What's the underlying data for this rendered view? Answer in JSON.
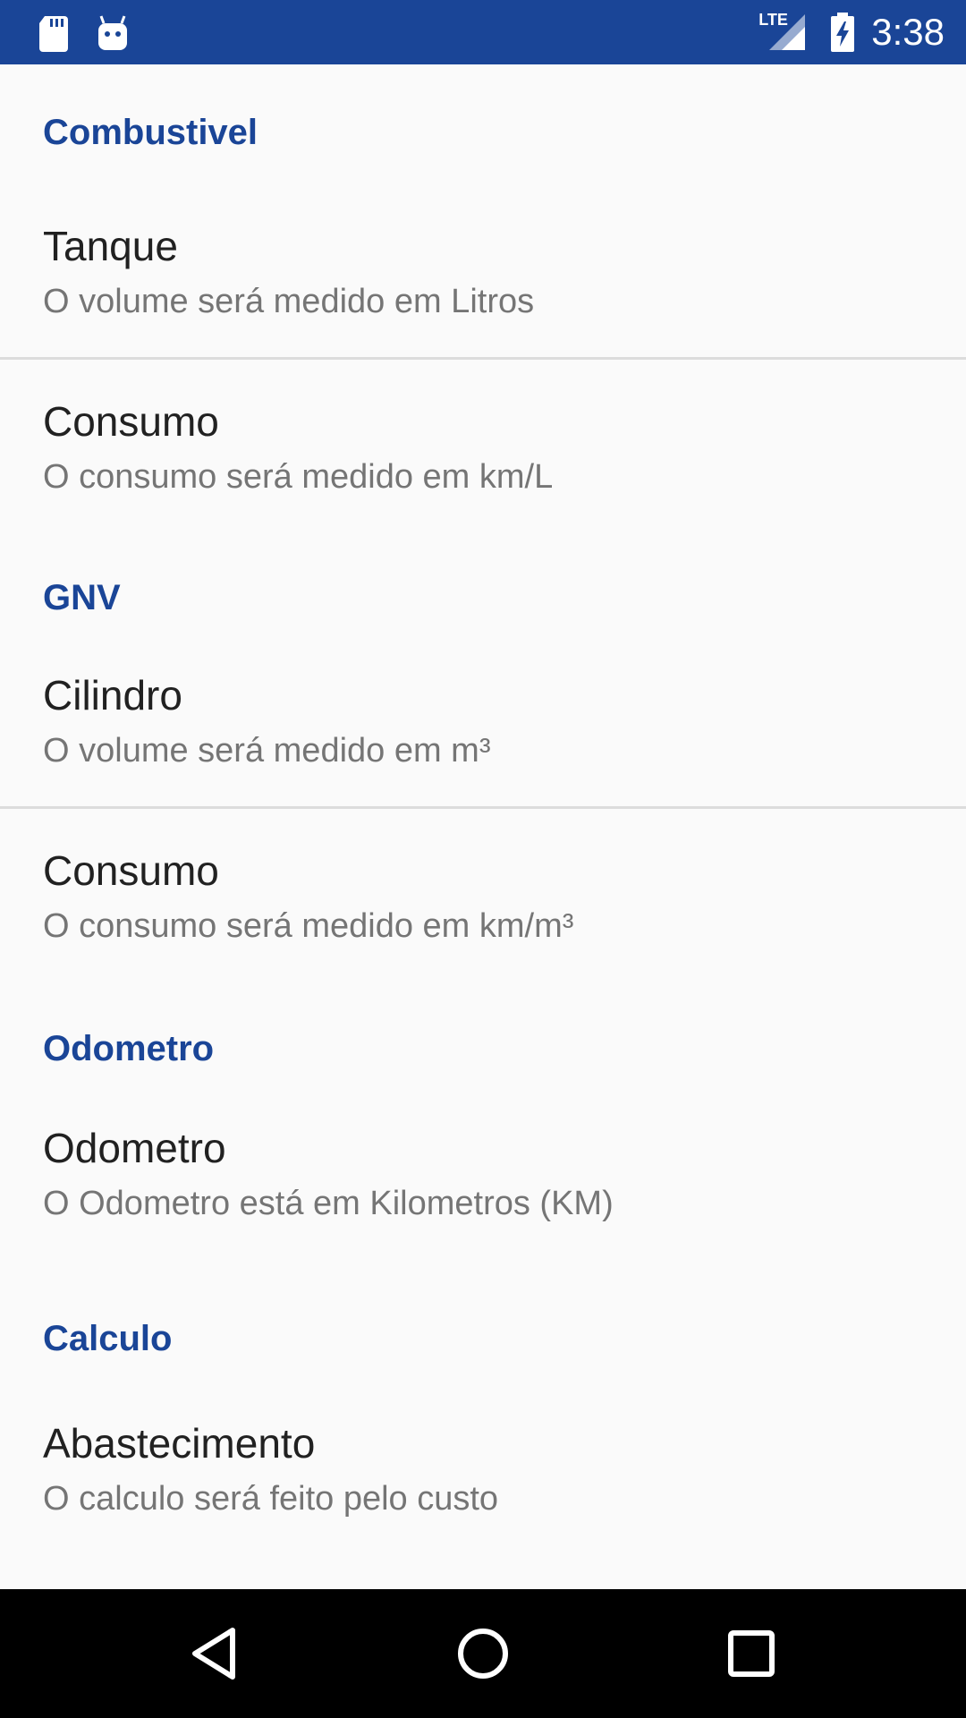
{
  "status_bar": {
    "time": "3:38",
    "network": "LTE",
    "icons": [
      "sd-card-icon",
      "android-icon",
      "lte-signal-icon",
      "battery-charging-icon"
    ],
    "background_color": "#1a4597"
  },
  "sections": [
    {
      "header": "Combustivel",
      "items": [
        {
          "title": "Tanque",
          "summary": "O volume será medido em Litros"
        },
        {
          "title": "Consumo",
          "summary": "O consumo será medido em km/L"
        }
      ]
    },
    {
      "header": "GNV",
      "items": [
        {
          "title": "Cilindro",
          "summary": "O volume será medido em m³"
        },
        {
          "title": "Consumo",
          "summary": "O consumo será medido em km/m³"
        }
      ]
    },
    {
      "header": "Odometro",
      "items": [
        {
          "title": "Odometro",
          "summary": "O Odometro está em Kilometros (KM)"
        }
      ]
    },
    {
      "header": "Calculo",
      "items": [
        {
          "title": "Abastecimento",
          "summary": "O calculo será feito pelo custo"
        }
      ]
    }
  ],
  "nav_bar": {
    "icons": [
      "back-icon",
      "home-icon",
      "recents-icon"
    ]
  },
  "colors": {
    "accent": "#1a4597",
    "title_text": "#212121",
    "summary_text": "#757575",
    "background": "#fafafa"
  }
}
